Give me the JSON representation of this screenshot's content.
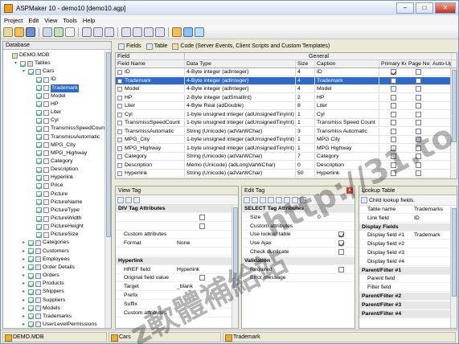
{
  "window": {
    "title": "ASPMaker 10 - demo10 [demo10.agp]",
    "min": "–",
    "max": "□",
    "close": "✕"
  },
  "menu": [
    "Project",
    "Edit",
    "View",
    "Tools",
    "Help"
  ],
  "db_panel": {
    "title": "Database",
    "tree": [
      {
        "label": "DEMO.MDB",
        "lvl": 0,
        "tw": "",
        "cb": false,
        "sel": false
      },
      {
        "label": "Tables",
        "lvl": 1,
        "tw": "▾",
        "cb": true,
        "sel": false
      },
      {
        "label": "Cars",
        "lvl": 2,
        "tw": "▾",
        "cb": true,
        "sel": false
      },
      {
        "label": "ID",
        "lvl": 3,
        "tw": "",
        "cb": true,
        "sel": false
      },
      {
        "label": "Trademark",
        "lvl": 3,
        "tw": "",
        "cb": true,
        "sel": true
      },
      {
        "label": "Model",
        "lvl": 3,
        "tw": "",
        "cb": true,
        "sel": false
      },
      {
        "label": "HP",
        "lvl": 3,
        "tw": "",
        "cb": true,
        "sel": false
      },
      {
        "label": "Liter",
        "lvl": 3,
        "tw": "",
        "cb": true,
        "sel": false
      },
      {
        "label": "Cyl",
        "lvl": 3,
        "tw": "",
        "cb": true,
        "sel": false
      },
      {
        "label": "TransmissSpeedCount",
        "lvl": 3,
        "tw": "",
        "cb": true,
        "sel": false
      },
      {
        "label": "TransmissAutomatic",
        "lvl": 3,
        "tw": "",
        "cb": true,
        "sel": false
      },
      {
        "label": "MPG_City",
        "lvl": 3,
        "tw": "",
        "cb": true,
        "sel": false
      },
      {
        "label": "MPG_Highway",
        "lvl": 3,
        "tw": "",
        "cb": true,
        "sel": false
      },
      {
        "label": "Category",
        "lvl": 3,
        "tw": "",
        "cb": true,
        "sel": false
      },
      {
        "label": "Description",
        "lvl": 3,
        "tw": "",
        "cb": true,
        "sel": false
      },
      {
        "label": "Hyperlink",
        "lvl": 3,
        "tw": "",
        "cb": true,
        "sel": false
      },
      {
        "label": "Price",
        "lvl": 3,
        "tw": "",
        "cb": true,
        "sel": false
      },
      {
        "label": "Picture",
        "lvl": 3,
        "tw": "",
        "cb": true,
        "sel": false
      },
      {
        "label": "PictureName",
        "lvl": 3,
        "tw": "",
        "cb": true,
        "sel": false
      },
      {
        "label": "PictureType",
        "lvl": 3,
        "tw": "",
        "cb": true,
        "sel": false
      },
      {
        "label": "PictureWidth",
        "lvl": 3,
        "tw": "",
        "cb": true,
        "sel": false
      },
      {
        "label": "PictureHeight",
        "lvl": 3,
        "tw": "",
        "cb": true,
        "sel": false
      },
      {
        "label": "PictureSize",
        "lvl": 3,
        "tw": "",
        "cb": true,
        "sel": false
      },
      {
        "label": "Categories",
        "lvl": 2,
        "tw": "▸",
        "cb": true,
        "sel": false
      },
      {
        "label": "Customers",
        "lvl": 2,
        "tw": "▸",
        "cb": true,
        "sel": false
      },
      {
        "label": "Employees",
        "lvl": 2,
        "tw": "▸",
        "cb": true,
        "sel": false
      },
      {
        "label": "Order Details",
        "lvl": 2,
        "tw": "▸",
        "cb": true,
        "sel": false
      },
      {
        "label": "Orders",
        "lvl": 2,
        "tw": "▸",
        "cb": true,
        "sel": false
      },
      {
        "label": "Products",
        "lvl": 2,
        "tw": "▸",
        "cb": true,
        "sel": false
      },
      {
        "label": "Shippers",
        "lvl": 2,
        "tw": "▸",
        "cb": true,
        "sel": false
      },
      {
        "label": "Suppliers",
        "lvl": 2,
        "tw": "▸",
        "cb": true,
        "sel": false
      },
      {
        "label": "Models",
        "lvl": 2,
        "tw": "▸",
        "cb": true,
        "sel": false
      },
      {
        "label": "Trademarks",
        "lvl": 2,
        "tw": "▸",
        "cb": true,
        "sel": false
      },
      {
        "label": "UserLevelPermissions",
        "lvl": 2,
        "tw": "▸",
        "cb": true,
        "sel": false
      }
    ]
  },
  "tabs": {
    "fields": "Fields",
    "table": "Table",
    "code": "Code (Server Events, Client Scripts and Custom Templates)"
  },
  "grid": {
    "group_field": "Field",
    "group_general": "General",
    "columns": [
      "Field Name",
      "Data Type",
      "Size",
      "Caption",
      "Primary Key",
      "Page No",
      "Auto-Upd"
    ],
    "rows": [
      {
        "name": "ID",
        "type": "4-Byte integer (adInteger)",
        "size": "4",
        "caption": "ID",
        "pk": true,
        "sel": false
      },
      {
        "name": "Trademark",
        "type": "4-Byte integer (adInteger)",
        "size": "4",
        "caption": "Trademark",
        "pk": false,
        "sel": true
      },
      {
        "name": "Model",
        "type": "4-Byte integer (adInteger)",
        "size": "4",
        "caption": "Model",
        "pk": false,
        "sel": false
      },
      {
        "name": "HP",
        "type": "2-Byte integer (adSmallInt)",
        "size": "2",
        "caption": "HP",
        "pk": false,
        "sel": false
      },
      {
        "name": "Liter",
        "type": "4-Byte Real (adDouble)",
        "size": "8",
        "caption": "Liter",
        "pk": false,
        "sel": false
      },
      {
        "name": "Cyl",
        "type": "1-byte unsigned integer (adUnsignedTinyInt)",
        "size": "1",
        "caption": "Cyl",
        "pk": false,
        "sel": false
      },
      {
        "name": "TransmissSpeedCount",
        "type": "1-byte unsigned integer (adUnsignedTinyInt)",
        "size": "1",
        "caption": "Transmiss Speed Count",
        "pk": false,
        "sel": false
      },
      {
        "name": "TransmissAutomatic",
        "type": "String (Unicode) (adVarWChar)",
        "size": "3",
        "caption": "Transmiss Automatic",
        "pk": false,
        "sel": false
      },
      {
        "name": "MPG_City",
        "type": "1-byte unsigned integer (adUnsignedTinyInt)",
        "size": "1",
        "caption": "MPG City",
        "pk": false,
        "sel": false
      },
      {
        "name": "MPG_Highway",
        "type": "1-byte unsigned integer (adUnsignedTinyInt)",
        "size": "1",
        "caption": "MPG Highway",
        "pk": false,
        "sel": false
      },
      {
        "name": "Category",
        "type": "String (Unicode) (adVarWChar)",
        "size": "7",
        "caption": "Category",
        "pk": false,
        "sel": false
      },
      {
        "name": "Description",
        "type": "Memo (Unicode) (adLongVarWChar)",
        "size": "0",
        "caption": "Description",
        "pk": false,
        "sel": false
      },
      {
        "name": "Hyperlink",
        "type": "String (Unicode) (adVarWChar)",
        "size": "50",
        "caption": "Hyperlink",
        "pk": false,
        "sel": false
      }
    ]
  },
  "view_tag": {
    "title": "View Tag",
    "rows": [
      {
        "k": "DIV Tag Attributes",
        "v": "",
        "sec": true,
        "cb": null
      },
      {
        "k": "",
        "v": "",
        "sec": false,
        "cb": false
      },
      {
        "k": "",
        "v": "",
        "sec": false,
        "cb": false
      },
      {
        "k": "Custom attributes",
        "v": "",
        "sec": false,
        "cb": null
      },
      {
        "k": "Format",
        "v": "None",
        "sec": false,
        "cb": null
      },
      {
        "k": "",
        "v": "",
        "sec": false,
        "cb": null
      },
      {
        "k": "Hyperlink",
        "v": "",
        "sec": true,
        "cb": null
      },
      {
        "k": "HREF field",
        "v": "Hyperlink",
        "sec": false,
        "cb": null
      },
      {
        "k": "Original field value",
        "v": "",
        "sec": false,
        "cb": false
      },
      {
        "k": "Target",
        "v": "_blank",
        "sec": false,
        "cb": null
      },
      {
        "k": "Prefix",
        "v": "",
        "sec": false,
        "cb": null
      },
      {
        "k": "Suffix",
        "v": "",
        "sec": false,
        "cb": null
      },
      {
        "k": "Custom attributes",
        "v": "",
        "sec": false,
        "cb": null
      }
    ]
  },
  "edit_tag": {
    "title": "Edit Tag",
    "rows": [
      {
        "k": "SELECT Tag Attributes",
        "v": "",
        "sec": true,
        "cb": null
      },
      {
        "k": "Size",
        "v": "0",
        "sec": false,
        "cb": null
      },
      {
        "k": "Custom attributes",
        "v": "",
        "sec": false,
        "cb": null
      },
      {
        "k": "Use lookup table",
        "v": "",
        "sec": false,
        "cb": true
      },
      {
        "k": "Use Ajax",
        "v": "",
        "sec": false,
        "cb": true
      },
      {
        "k": "Check duplicate",
        "v": "",
        "sec": false,
        "cb": false
      },
      {
        "k": "Validation",
        "v": "",
        "sec": true,
        "cb": null
      },
      {
        "k": "Required",
        "v": "",
        "sec": false,
        "cb": false
      },
      {
        "k": "Error message",
        "v": "",
        "sec": false,
        "cb": null
      }
    ]
  },
  "lookup_table": {
    "title": "Lookup Table",
    "child_label": "Child lookup fields.",
    "rows": [
      {
        "k": "Table name",
        "v": "Trademarks",
        "sec": false
      },
      {
        "k": "Link field",
        "v": "ID",
        "sec": false
      },
      {
        "k": "Display Fields",
        "v": "",
        "sec": true
      },
      {
        "k": "Display field #1",
        "v": "Trademark",
        "sec": false
      },
      {
        "k": "Display field #2",
        "v": "",
        "sec": false
      },
      {
        "k": "Display field #3",
        "v": "",
        "sec": false
      },
      {
        "k": "Display field #4",
        "v": "",
        "sec": false
      },
      {
        "k": "Parent/Filter #1",
        "v": "",
        "sec": true
      },
      {
        "k": "Parent field",
        "v": "",
        "sec": false
      },
      {
        "k": "Filter field",
        "v": "",
        "sec": false
      },
      {
        "k": "Parent/Filter #2",
        "v": "",
        "sec": true
      },
      {
        "k": "Parent/Filter #3",
        "v": "",
        "sec": true
      },
      {
        "k": "Parent/Filter #4",
        "v": "",
        "sec": true
      }
    ]
  },
  "status": {
    "db": "DEMO.MDB",
    "table": "Cars",
    "field": "Trademark"
  },
  "watermarks": {
    "cjk": "z軟體補給站",
    "url": "http://31.to"
  }
}
